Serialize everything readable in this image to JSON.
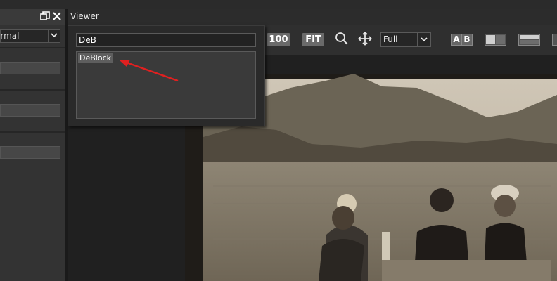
{
  "left_panel": {
    "blend_mode_value": "ormal",
    "icons": [
      "restore-icon",
      "close-icon"
    ]
  },
  "viewer": {
    "title": "Viewer",
    "toolbar": {
      "zoom_100_label": "100",
      "fit_label": "FIT",
      "view_select_value": "Full",
      "ab_a_label": "A",
      "ab_b_label": "B",
      "icons": [
        "zoom-icon",
        "pan-move-icon",
        "split-vertical-icon",
        "split-horizontal-icon"
      ]
    }
  },
  "search_popup": {
    "query": "DeB",
    "results": [
      {
        "label": "DeBlock"
      }
    ]
  },
  "annotation": {
    "arrow_color": "#e02020"
  },
  "colors": {
    "panel_bg": "#333333",
    "viewer_bg": "#222222",
    "button_gray": "#6a6a6a",
    "highlight": "#5e5e5e"
  }
}
